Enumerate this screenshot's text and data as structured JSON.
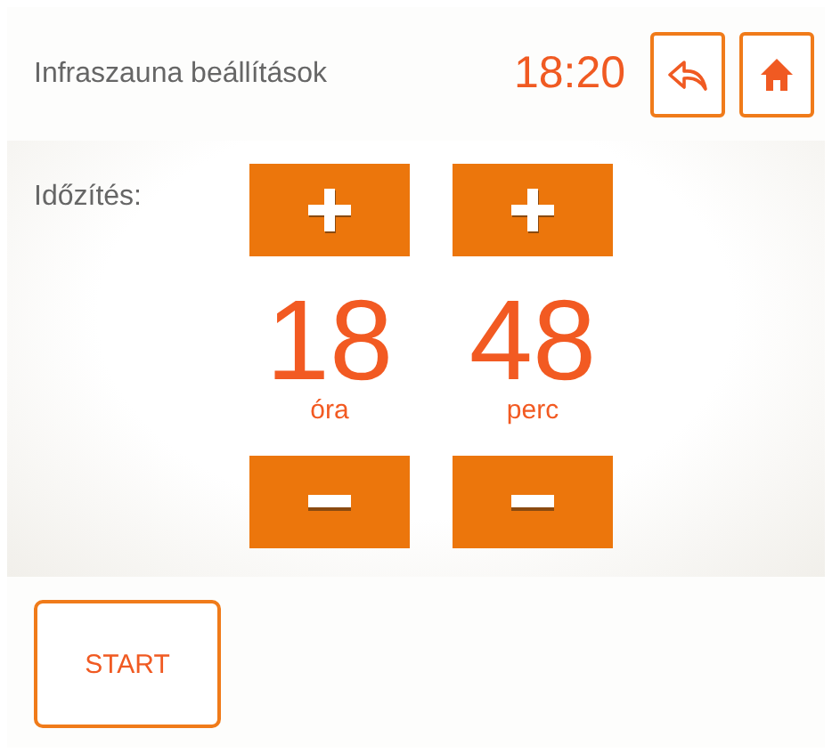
{
  "header": {
    "title": "Infraszauna beállítások",
    "time": "18:20"
  },
  "timer": {
    "label": "Időzítés:",
    "units": [
      {
        "value": "18",
        "unit": "óra"
      },
      {
        "value": "48",
        "unit": "perc"
      }
    ]
  },
  "footer": {
    "start_button": "START"
  }
}
